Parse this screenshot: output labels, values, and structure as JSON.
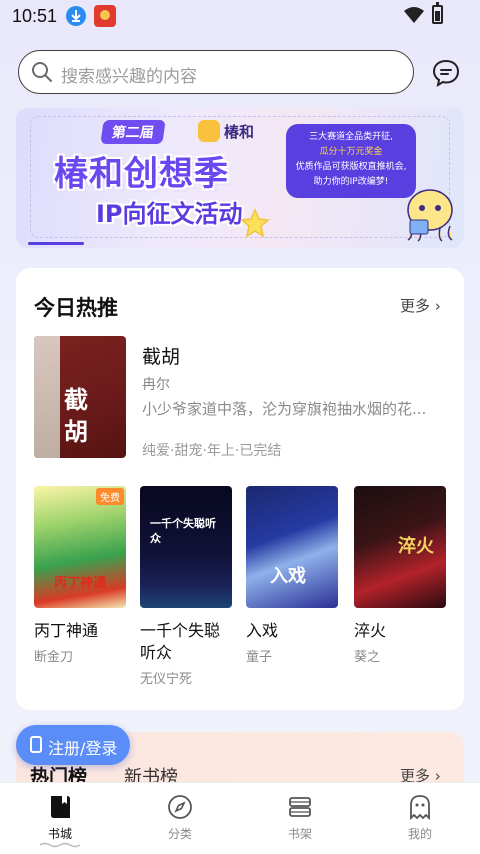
{
  "status_bar": {
    "time": "10:51"
  },
  "search": {
    "placeholder": "搜索感兴趣的内容"
  },
  "banner": {
    "tag": "第二届",
    "brand": "椿和",
    "title": "椿和创想季",
    "subtitle": "IP向征文活动",
    "info_lines": [
      "三大赛道全品类开征,",
      "瓜分十万元奖金",
      "优质作品可获版权直推机会,",
      "助力你的IP改编梦!"
    ]
  },
  "today_hot": {
    "title": "今日热推",
    "more": "更多",
    "featured": {
      "cover_text": "截胡",
      "title": "截胡",
      "author": "冉尔",
      "description": "小少爷家道中落，沦为穿旗袍抽水烟的花...",
      "tags": "纯爱·甜宠·年上·已完结"
    },
    "books": [
      {
        "title": "丙丁神通",
        "author": "断金刀",
        "badge": "免费",
        "cover_text": "丙丁神通"
      },
      {
        "title": "一千个失聪听众",
        "author": "无仪宁死",
        "cover_text": "一千个失聪听众"
      },
      {
        "title": "入戏",
        "author": "童子",
        "cover_text": "入戏"
      },
      {
        "title": "淬火",
        "author": "葵之",
        "cover_text": "淬火"
      }
    ]
  },
  "ranking": {
    "tab_hot": "热门榜",
    "tab_new": "新书榜",
    "more": "更多"
  },
  "login": {
    "label": "注册/登录"
  },
  "bottom_nav": [
    {
      "label": "书城",
      "icon": "book-icon",
      "active": true
    },
    {
      "label": "分类",
      "icon": "compass-icon",
      "active": false
    },
    {
      "label": "书架",
      "icon": "bookshelf-icon",
      "active": false
    },
    {
      "label": "我的",
      "icon": "ghost-icon",
      "active": false
    }
  ],
  "colors": {
    "accent": "#5b8df8",
    "banner_purple": "#6a47ef"
  }
}
